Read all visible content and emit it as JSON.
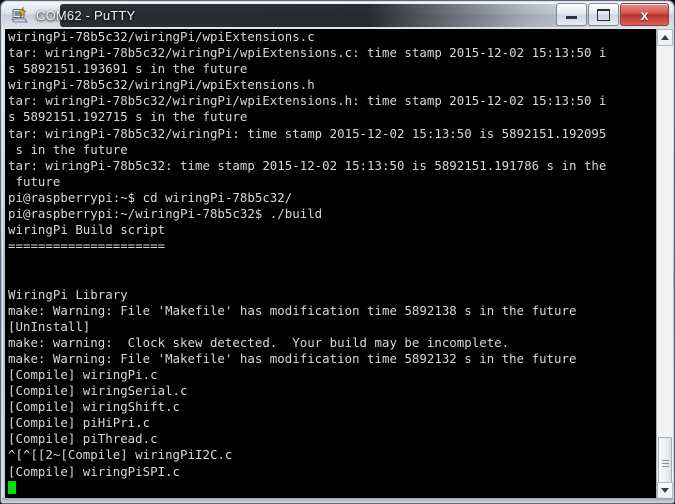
{
  "window": {
    "title": "COM62 - PuTTY",
    "icon": "putty-icon",
    "buttons": {
      "minimize": "Minimize",
      "maximize": "Restore",
      "close": "Close",
      "close_glyph": "x"
    }
  },
  "terminal": {
    "background": "#000000",
    "foreground": "#d8d8d8",
    "cursor_color": "#00e000",
    "columns": 78,
    "rows": 29,
    "lines": [
      "wiringPi-78b5c32/wiringPi/wpiExtensions.c",
      "tar: wiringPi-78b5c32/wiringPi/wpiExtensions.c: time stamp 2015-12-02 15:13:50 i",
      "s 5892151.193691 s in the future",
      "wiringPi-78b5c32/wiringPi/wpiExtensions.h",
      "tar: wiringPi-78b5c32/wiringPi/wpiExtensions.h: time stamp 2015-12-02 15:13:50 i",
      "s 5892151.192715 s in the future",
      "tar: wiringPi-78b5c32/wiringPi: time stamp 2015-12-02 15:13:50 is 5892151.192095",
      " s in the future",
      "tar: wiringPi-78b5c32: time stamp 2015-12-02 15:13:50 is 5892151.191786 s in the",
      " future",
      "pi@raspberrypi:~$ cd wiringPi-78b5c32/",
      "pi@raspberrypi:~/wiringPi-78b5c32$ ./build",
      "wiringPi Build script",
      "=====================",
      "",
      "",
      "WiringPi Library",
      "make: Warning: File 'Makefile' has modification time 5892138 s in the future",
      "[UnInstall]",
      "make: warning:  Clock skew detected.  Your build may be incomplete.",
      "make: Warning: File 'Makefile' has modification time 5892132 s in the future",
      "[Compile] wiringPi.c",
      "[Compile] wiringSerial.c",
      "[Compile] wiringShift.c",
      "[Compile] piHiPri.c",
      "[Compile] piThread.c",
      "^[^[[2~[Compile] wiringPiI2C.c",
      "[Compile] wiringPiSPI.c"
    ]
  },
  "scrollbar": {
    "up_arrow": "scroll-up",
    "down_arrow": "scroll-down",
    "thumb": "scroll-thumb"
  }
}
